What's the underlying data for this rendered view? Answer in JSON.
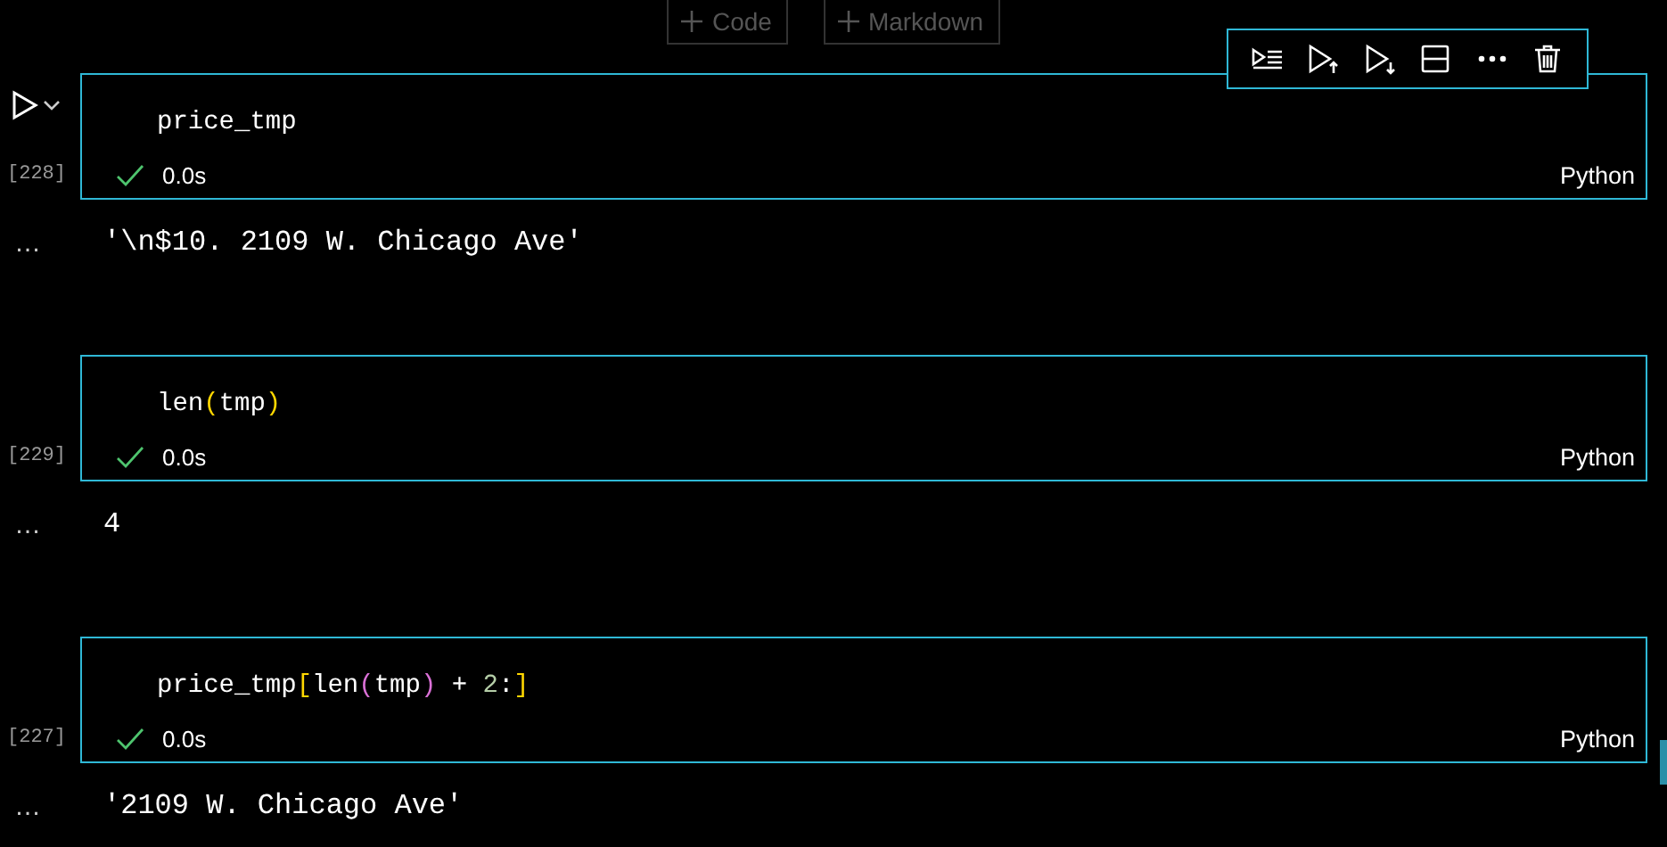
{
  "insert_buttons": [
    {
      "label": "Code"
    },
    {
      "label": "Markdown"
    }
  ],
  "cells": [
    {
      "hovered": true,
      "execution_count": "[228]",
      "succeeded": true,
      "duration": "0.0s",
      "language": "Python",
      "code": [
        {
          "text": "price_tmp",
          "color": "#ffffff"
        }
      ],
      "output_prefix": "…",
      "output": "'\\n$10. 2109 W. Chicago Ave'"
    },
    {
      "hovered": false,
      "execution_count": "[229]",
      "succeeded": true,
      "duration": "0.0s",
      "language": "Python",
      "code": [
        {
          "text": "len",
          "color": "#ffffff"
        },
        {
          "text": "(",
          "color": "#ffd700"
        },
        {
          "text": "tmp",
          "color": "#ffffff"
        },
        {
          "text": ")",
          "color": "#ffd700"
        }
      ],
      "output_prefix": "…",
      "output": "4"
    },
    {
      "hovered": false,
      "execution_count": "[227]",
      "succeeded": true,
      "duration": "0.0s",
      "language": "Python",
      "code": [
        {
          "text": "price_tmp",
          "color": "#ffffff"
        },
        {
          "text": "[",
          "color": "#ffd700"
        },
        {
          "text": "len",
          "color": "#ffffff"
        },
        {
          "text": "(",
          "color": "#da70d6"
        },
        {
          "text": "tmp",
          "color": "#ffffff"
        },
        {
          "text": ")",
          "color": "#da70d6"
        },
        {
          "text": " + ",
          "color": "#ffffff"
        },
        {
          "text": "2",
          "color": "#b5cea8"
        },
        {
          "text": ":",
          "color": "#ffffff"
        },
        {
          "text": "]",
          "color": "#ffd700"
        }
      ],
      "output_prefix": "…",
      "output": "'2109 W. Chicago Ave'"
    }
  ]
}
